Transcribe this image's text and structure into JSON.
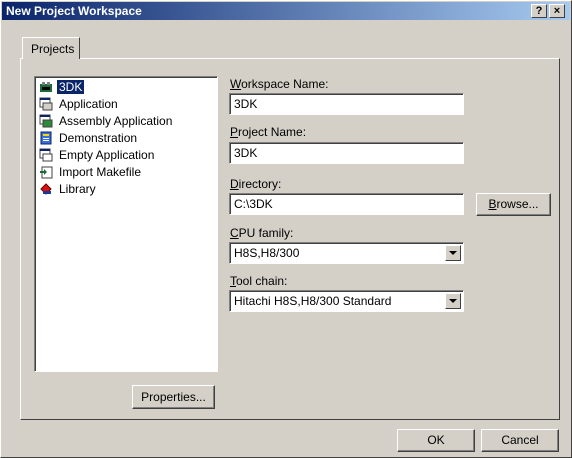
{
  "window": {
    "title": "New Project Workspace",
    "help_button": "?",
    "close_button": "×"
  },
  "tabs": [
    {
      "label": "Projects",
      "active": true
    }
  ],
  "project_types": [
    {
      "label": "3DK",
      "icon": "3dk-board-icon",
      "selected": true
    },
    {
      "label": "Application",
      "icon": "application-icon",
      "selected": false
    },
    {
      "label": "Assembly Application",
      "icon": "assembly-application-icon",
      "selected": false
    },
    {
      "label": "Demonstration",
      "icon": "demonstration-icon",
      "selected": false
    },
    {
      "label": "Empty Application",
      "icon": "empty-application-icon",
      "selected": false
    },
    {
      "label": "Import Makefile",
      "icon": "import-makefile-icon",
      "selected": false
    },
    {
      "label": "Library",
      "icon": "library-icon",
      "selected": false
    }
  ],
  "form": {
    "workspace_name_label_pre": "",
    "workspace_name_label_key": "W",
    "workspace_name_label_post": "orkspace Name:",
    "workspace_name_value": "3DK",
    "project_name_label_key": "P",
    "project_name_label_post": "roject Name:",
    "project_name_value": "3DK",
    "directory_label_key": "D",
    "directory_label_post": "irectory:",
    "directory_value": "C:\\3DK",
    "cpu_family_label_key": "C",
    "cpu_family_label_post": "PU family:",
    "cpu_family_value": "H8S,H8/300",
    "tool_chain_label_key": "T",
    "tool_chain_label_post": "ool chain:",
    "tool_chain_value": "Hitachi H8S,H8/300 Standard"
  },
  "buttons": {
    "browse_key": "B",
    "browse_post": "rowse...",
    "properties": "Properties...",
    "ok": "OK",
    "cancel": "Cancel"
  },
  "colors": {
    "title_active": "#0a246a",
    "selection": "#0a246a",
    "face": "#d4d0c8"
  }
}
